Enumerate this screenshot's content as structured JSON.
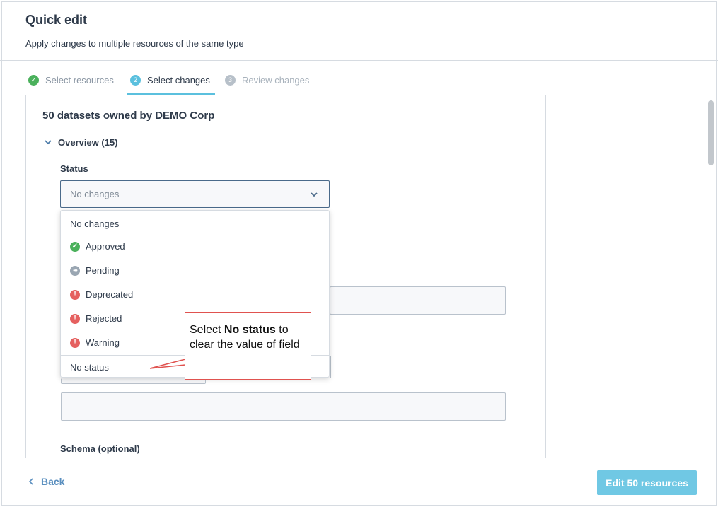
{
  "header": {
    "title": "Quick edit",
    "subtitle": "Apply changes to multiple resources of the same type"
  },
  "steps": [
    {
      "label": "Select resources",
      "badge": "✓",
      "state": "complete"
    },
    {
      "label": "Select changes",
      "badge": "2",
      "state": "active"
    },
    {
      "label": "Review changes",
      "badge": "3",
      "state": "upcoming"
    }
  ],
  "main": {
    "heading": "50 datasets owned by DEMO Corp",
    "overview_label": "Overview (15)",
    "status_label": "Status",
    "status_select_value": "No changes",
    "schema_label": "Schema (optional)"
  },
  "dropdown": {
    "options": [
      {
        "label": "No changes",
        "icon": "none"
      },
      {
        "label": "Approved",
        "icon": "check-circle-icon"
      },
      {
        "label": "Pending",
        "icon": "ellipsis-circle-icon"
      },
      {
        "label": "Deprecated",
        "icon": "alert-circle-icon"
      },
      {
        "label": "Rejected",
        "icon": "alert-circle-icon"
      },
      {
        "label": "Warning",
        "icon": "alert-circle-icon"
      },
      {
        "label": "No status",
        "icon": "none"
      }
    ]
  },
  "callout": {
    "prefix": "Select ",
    "bold": "No status",
    "suffix": " to clear the value of field"
  },
  "footer": {
    "back_label": "Back",
    "submit_label": "Edit 50 resources"
  },
  "colors": {
    "accent": "#5bc0de",
    "success": "#4bb15c",
    "danger": "#e5605f",
    "callout_border": "#e0524f",
    "primary_button": "#70c8e4"
  }
}
